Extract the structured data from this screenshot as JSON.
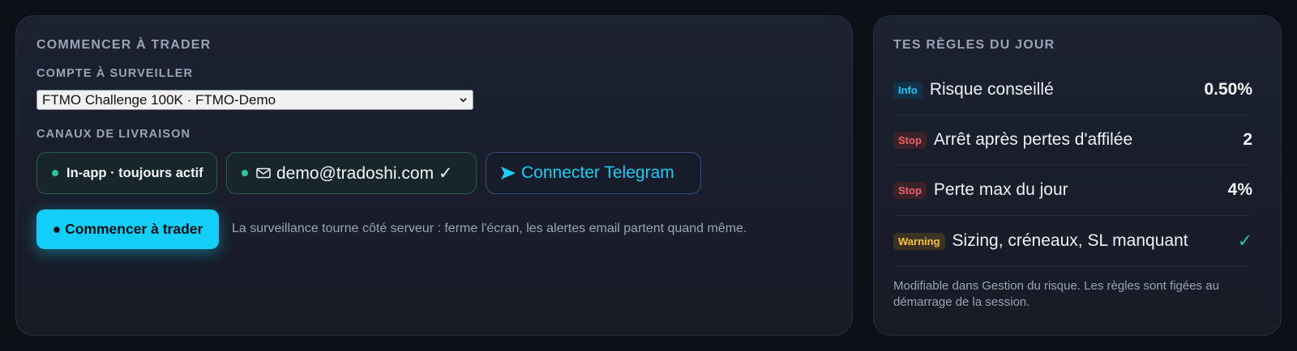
{
  "start_card": {
    "title": "COMMENCER À TRADER",
    "account_label": "COMPTE À SURVEILLER",
    "account_selected": "FTMO Challenge 100K · FTMO-Demo",
    "channels_label": "CANAUX DE LIVRAISON",
    "channels": {
      "inapp": "In-app · toujours actif",
      "email": "demo@tradoshi.com ✓",
      "telegram": "Connecter Telegram"
    },
    "start_button": "● Commencer à trader",
    "hint": "La surveillance tourne côté serveur : ferme l'écran, les alertes email partent quand même."
  },
  "rules_card": {
    "title": "TES RÈGLES DU JOUR",
    "rules": [
      {
        "badge": "Info",
        "label": "Risque conseillé",
        "value": "0.50%"
      },
      {
        "badge": "Stop",
        "label": "Arrêt après pertes d'affilée",
        "value": "2"
      },
      {
        "badge": "Stop",
        "label": "Perte max du jour",
        "value": "4%"
      },
      {
        "badge": "Warning",
        "label": "Sizing, créneaux, SL manquant",
        "value": "✓"
      }
    ],
    "footnote": "Modifiable dans Gestion du risque. Les règles sont figées au démarrage de la session."
  },
  "colors": {
    "accent": "#13cef6",
    "success": "#2fc39a",
    "stop": "#f0606a",
    "warning": "#f5c33a",
    "background": "#0d1017"
  },
  "icons": [
    "chevron-down-icon",
    "mail-icon",
    "telegram-arrow-icon",
    "status-dot-icon",
    "check-icon"
  ]
}
